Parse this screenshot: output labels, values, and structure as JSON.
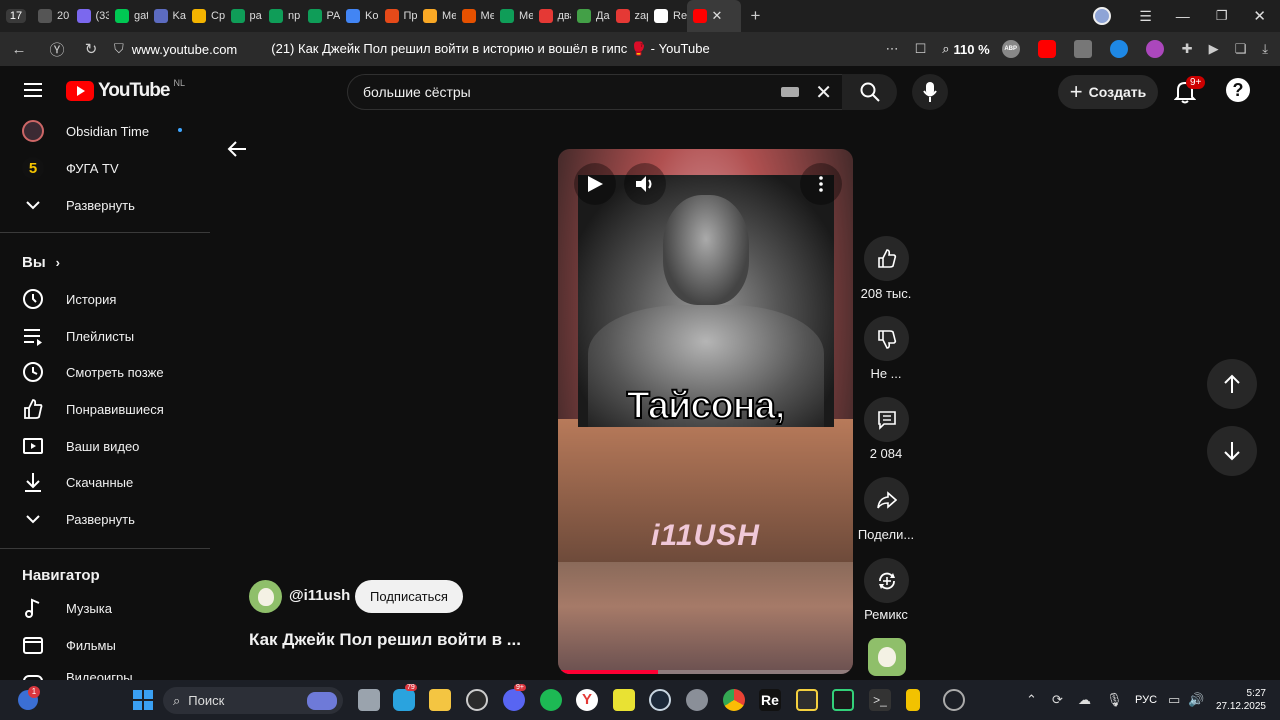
{
  "browser": {
    "tab_count": "17",
    "tabs": [
      {
        "label": "20 я",
        "color": "#555555"
      },
      {
        "label": "(33",
        "color": "#7b68ee"
      },
      {
        "label": "gat",
        "color": "#00c853"
      },
      {
        "label": "Ka",
        "color": "#5c6bc0"
      },
      {
        "label": "Cp",
        "color": "#f4b400"
      },
      {
        "label": "pa",
        "color": "#0f9d58"
      },
      {
        "label": "np",
        "color": "#0f9d58"
      },
      {
        "label": "PA",
        "color": "#0f9d58"
      },
      {
        "label": "Ko",
        "color": "#4285f4"
      },
      {
        "label": "Пр",
        "color": "#e64a19"
      },
      {
        "label": "Ме",
        "color": "#f9a825"
      },
      {
        "label": "Ме",
        "color": "#e65100"
      },
      {
        "label": "Ме",
        "color": "#0f9d58"
      },
      {
        "label": "два",
        "color": "#e53935"
      },
      {
        "label": "Да",
        "color": "#43a047"
      },
      {
        "label": "zap",
        "color": "#e53935"
      },
      {
        "label": "Rel",
        "color": "#ffffff"
      }
    ],
    "url": "www.youtube.com",
    "page_title": "(21) Как Джейк Пол решил войти в историю и вошёл в гипс 🥊 - YouTube",
    "zoom": "110 %",
    "abp_label": "ABP"
  },
  "youtube": {
    "logo_text": "YouTube",
    "region": "NL",
    "search_value": "большие сёстры",
    "create_label": "Создать",
    "notif_badge": "9+",
    "sidebar": {
      "subs": [
        {
          "label": "Obsidian Time"
        },
        {
          "label": "ФУГА TV"
        },
        {
          "label": "Развернуть"
        }
      ],
      "you_header": "Вы",
      "you_items": [
        {
          "label": "История"
        },
        {
          "label": "Плейлисты"
        },
        {
          "label": "Смотреть позже"
        },
        {
          "label": "Понравившиеся"
        },
        {
          "label": "Ваши видео"
        },
        {
          "label": "Скачанные"
        },
        {
          "label": "Развернуть"
        }
      ],
      "nav_header": "Навигатор",
      "nav_items": [
        {
          "label": "Музыка"
        },
        {
          "label": "Фильмы"
        },
        {
          "label": "Видеоигры"
        }
      ]
    },
    "short": {
      "caption": "Тайсона,",
      "watermark": "i11USH",
      "channel": "@i11ush",
      "subscribe_label": "Подписаться",
      "title": "Как Джейк Пол решил войти в ...",
      "likes": "208 тыс.",
      "dislike_label": "Не ...",
      "comments": "2 084",
      "share_label": "Подели...",
      "remix_label": "Ремикс"
    }
  },
  "taskbar": {
    "search_label": "Поиск",
    "lang": "РУС",
    "time": "5:27",
    "date": "27.12.2025",
    "badge_count": "1",
    "telegram_badge": "79",
    "discord_badge": "9+"
  }
}
